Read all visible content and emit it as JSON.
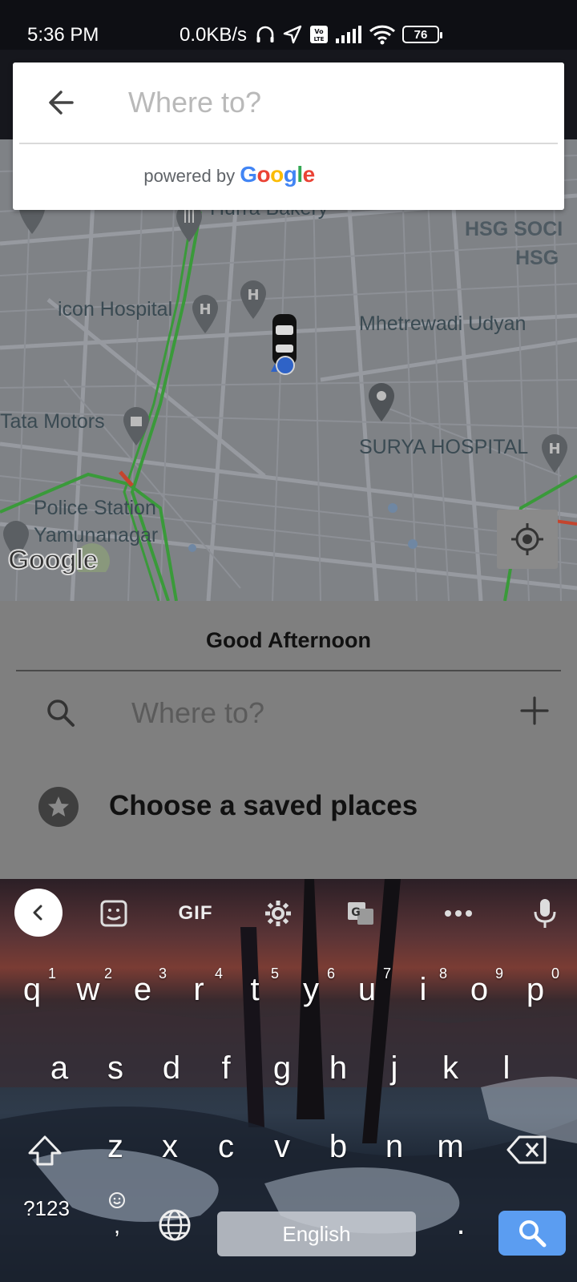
{
  "status_bar": {
    "time": "5:36 PM",
    "network_speed": "0.0KB/s",
    "battery": "76",
    "icons": [
      "headphones-icon",
      "location-arrow-icon",
      "volte-icon",
      "signal-icon",
      "wifi-icon",
      "battery-icon"
    ]
  },
  "search_card": {
    "placeholder": "Where to?",
    "powered_by": "powered by",
    "google_letters": [
      "G",
      "o",
      "o",
      "g",
      "l",
      "e"
    ],
    "google_colors": [
      "#4285F4",
      "#EA4335",
      "#FBBC05",
      "#4285F4",
      "#34A853",
      "#EA4335"
    ]
  },
  "map": {
    "labels": {
      "bakery": "Hurra Bakery",
      "hsg1": "HSG SOCI",
      "hsg2": "HSG",
      "hospital": "icon Hospital",
      "udyan": "Mhetrewadi Udyan",
      "tata": "Tata Motors",
      "surya": "SURYA HOSPITAL",
      "police1": "Police Station",
      "police2": "Yamunanagar"
    },
    "watermark": "Google",
    "colors": {
      "background": "#7f8286",
      "road": "#9a9ea2",
      "traffic_green": "#3a9a3a",
      "traffic_red": "#c4452e",
      "label": "#3a4a52"
    }
  },
  "sheet": {
    "greeting": "Good Afternoon",
    "search_placeholder": "Where to?",
    "saved_places": "Choose a saved places"
  },
  "keyboard": {
    "toolbar": {
      "gif": "GIF"
    },
    "row1": [
      {
        "k": "q",
        "n": "1"
      },
      {
        "k": "w",
        "n": "2"
      },
      {
        "k": "e",
        "n": "3"
      },
      {
        "k": "r",
        "n": "4"
      },
      {
        "k": "t",
        "n": "5"
      },
      {
        "k": "y",
        "n": "6"
      },
      {
        "k": "u",
        "n": "7"
      },
      {
        "k": "i",
        "n": "8"
      },
      {
        "k": "o",
        "n": "9"
      },
      {
        "k": "p",
        "n": "0"
      }
    ],
    "row2": [
      "a",
      "s",
      "d",
      "f",
      "g",
      "h",
      "j",
      "k",
      "l"
    ],
    "row3": [
      "z",
      "x",
      "c",
      "v",
      "b",
      "n",
      "m"
    ],
    "symbols": "?123",
    "comma": ",",
    "period": ".",
    "space_label": "English"
  }
}
